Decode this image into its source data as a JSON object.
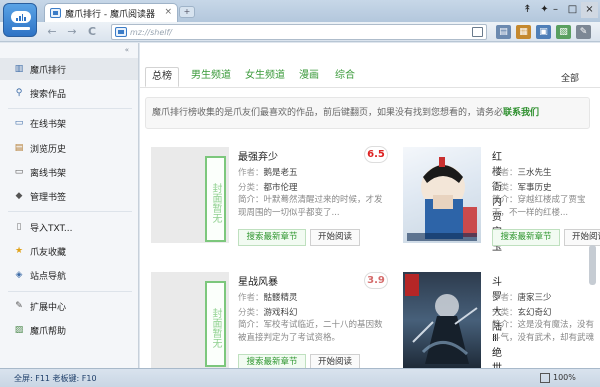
{
  "window": {
    "tab_title": "魔爪排行 - 魔爪阅读器",
    "tab_close": "×",
    "new_tab": "+",
    "controls_left": [
      "↟",
      "✦"
    ],
    "controls_right": [
      "–",
      "□",
      "×"
    ]
  },
  "address": {
    "back": "←",
    "forward": "→",
    "reload": "C",
    "url": "mz://shelf/",
    "tool_icons": [
      "reader-icon",
      "book-icon",
      "grid-icon",
      "image-icon",
      "tools-icon"
    ],
    "tool_glyphs": [
      "▤",
      "▦",
      "▣",
      "▧",
      "✎"
    ]
  },
  "sidebar": {
    "collapse": "«",
    "items": [
      {
        "label": "魔爪排行",
        "icon": "ranking-icon",
        "glyph": "▥"
      },
      {
        "label": "搜索作品",
        "icon": "search-icon",
        "glyph": "⚲"
      },
      {
        "label": "在线书架",
        "icon": "bookshelf-icon",
        "glyph": "▭"
      },
      {
        "label": "浏览历史",
        "icon": "history-icon",
        "glyph": "▤"
      },
      {
        "label": "离线书架",
        "icon": "offline-shelf-icon",
        "glyph": "▭"
      },
      {
        "label": "管理书签",
        "icon": "bookmark-icon",
        "glyph": "◆"
      },
      {
        "label": "导入TXT...",
        "icon": "import-icon",
        "glyph": "▯"
      },
      {
        "label": "爪友收藏",
        "icon": "star-icon",
        "glyph": "★"
      },
      {
        "label": "站点导航",
        "icon": "navigation-icon",
        "glyph": "◈"
      },
      {
        "label": "扩展中心",
        "icon": "extension-icon",
        "glyph": "✎"
      },
      {
        "label": "魔爪帮助",
        "icon": "help-icon",
        "glyph": "▨"
      }
    ]
  },
  "categories": {
    "tabs": [
      "总榜",
      "男生频道",
      "女生频道",
      "漫画",
      "综合"
    ],
    "all_label": "全部"
  },
  "notice": {
    "text": "魔爪排行榜收集的是爪友们最喜欢的作品，前后键翻页，如果没有找到您想看的，请务必",
    "link": "联系我们"
  },
  "labels": {
    "author": "作者：",
    "category": "分类：",
    "intro": "简介：",
    "search_btn": "搜索最新章节",
    "read_btn": "开始阅读",
    "no_cover": "封面暂无"
  },
  "books": [
    {
      "title": "最强弃少",
      "score": "6.5",
      "author": "鹅是老五",
      "category": "都市伦理",
      "intro": "叶默蓦然清醒过来的时候，才发现周围的一切似乎都变了..."
    },
    {
      "title": "红楼衙内贾宝玉",
      "score": "",
      "author": "三水先生",
      "category": "军事历史",
      "intro": "穿越红楼成了贾宝玉，不一样的红楼..."
    },
    {
      "title": "星战风暴",
      "score": "3.9",
      "author": "骷髅精灵",
      "category": "游戏科幻",
      "intro": "军校考试临近，二十八的基因数被直接判定为了考试资格。"
    },
    {
      "title": "斗罗大陆Ⅲ绝世唐门",
      "score": "",
      "author": "唐家三少",
      "category": "玄幻奇幻",
      "intro": "这是没有魔法，没有斗气，没有武术，却有武魂的唐门世界..."
    }
  ],
  "status": {
    "text": "全屏: F11 老板键: F10",
    "zoom": "100%"
  },
  "colors": {
    "accent_green": "#2f962f",
    "score_red": "#d22222",
    "chrome_blue": "#b3c7dc"
  }
}
